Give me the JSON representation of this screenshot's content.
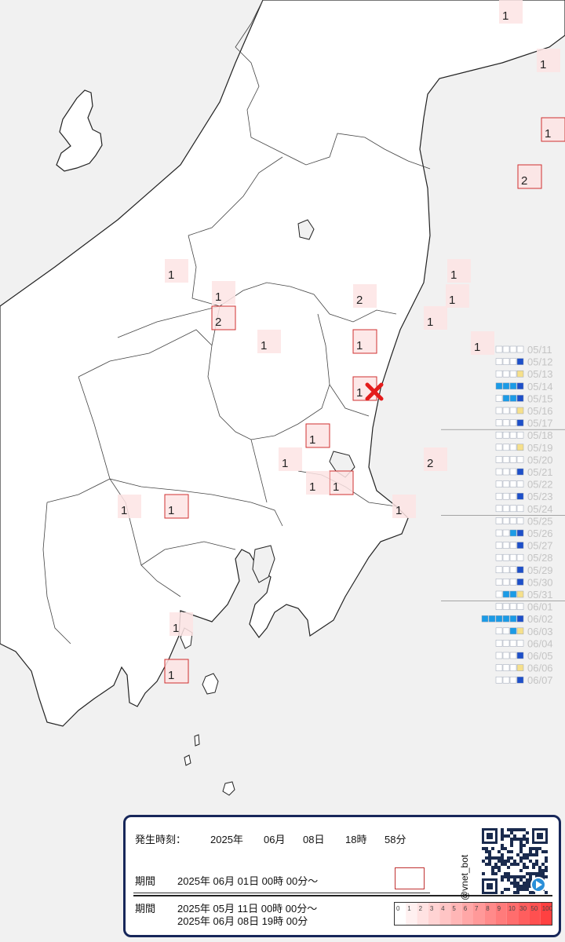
{
  "map_title": "",
  "cells": [
    {
      "n": "1",
      "boxed": false
    },
    {
      "n": "1",
      "boxed": true
    },
    {
      "n": "2",
      "boxed": true
    },
    {
      "n": "1",
      "boxed": false
    },
    {
      "n": "1",
      "boxed": false
    },
    {
      "n": "1",
      "boxed": false
    },
    {
      "n": "1",
      "boxed": true
    },
    {
      "n": "1",
      "boxed": false
    },
    {
      "n": "2",
      "boxed": false
    },
    {
      "n": "2",
      "boxed": true
    },
    {
      "n": "1",
      "boxed": false
    },
    {
      "n": "1",
      "boxed": false
    },
    {
      "n": "1",
      "boxed": false
    },
    {
      "n": "1",
      "boxed": true
    },
    {
      "n": "1",
      "boxed": false
    },
    {
      "n": "1",
      "boxed": true
    },
    {
      "n": "1",
      "boxed": false
    },
    {
      "n": "2",
      "boxed": false
    },
    {
      "n": "1",
      "boxed": false
    },
    {
      "n": "1",
      "boxed": true
    },
    {
      "n": "1",
      "boxed": false
    },
    {
      "n": "1",
      "boxed": false
    },
    {
      "n": "1",
      "boxed": true
    },
    {
      "n": "1",
      "boxed": false
    },
    {
      "n": "1",
      "boxed": true
    }
  ],
  "epicenter_symbol": "x-mark-icon",
  "histogram_dates": [
    "05/11",
    "05/12",
    "05/13",
    "05/14",
    "05/15",
    "05/16",
    "05/17",
    "05/18",
    "05/19",
    "05/20",
    "05/21",
    "05/22",
    "05/23",
    "05/24",
    "05/25",
    "05/26",
    "05/27",
    "05/28",
    "05/29",
    "05/30",
    "05/31",
    "06/01",
    "06/02",
    "06/03",
    "06/04",
    "06/05",
    "06/06",
    "06/07"
  ],
  "histogram_counts": [
    0,
    1,
    1,
    4,
    3,
    1,
    1,
    0,
    1,
    0,
    1,
    0,
    1,
    0,
    0,
    2,
    1,
    0,
    1,
    1,
    3,
    0,
    6,
    2,
    0,
    1,
    1,
    1
  ],
  "info": {
    "occ_label": "発生時刻：",
    "occ_year": "2025年",
    "occ_month": "06月",
    "occ_day": "08日",
    "occ_hour": "18時",
    "occ_min": "58分",
    "period1_label": "期間",
    "period1_text": "2025年 06月 01日 00時 00分～",
    "period2_label": "期間",
    "period2_line1": "2025年 05月 11日 00時 00分～",
    "period2_line2": "2025年 06月 08日 19時 00分",
    "bot_handle": "@vnet_bot",
    "scale_ticks": [
      "0",
      "1",
      "2",
      "3",
      "4",
      "5",
      "6",
      "7",
      "8",
      "9",
      "10",
      "30",
      "50",
      "100"
    ]
  },
  "colors": {
    "land": "#ffffff",
    "sea": "#f1f1f1",
    "coast": "#222222",
    "cell_fill": "#fde4e4",
    "cell_box": "#d03030",
    "epicenter": "#e41b1b",
    "hist_dark": "#1d4fc9",
    "hist_light": "#1b9be6",
    "hist_yellow": "#f6e08b",
    "info_border": "#17275a",
    "qr_dark": "#1a2b4e",
    "play_badge": "#2a8fd8"
  }
}
